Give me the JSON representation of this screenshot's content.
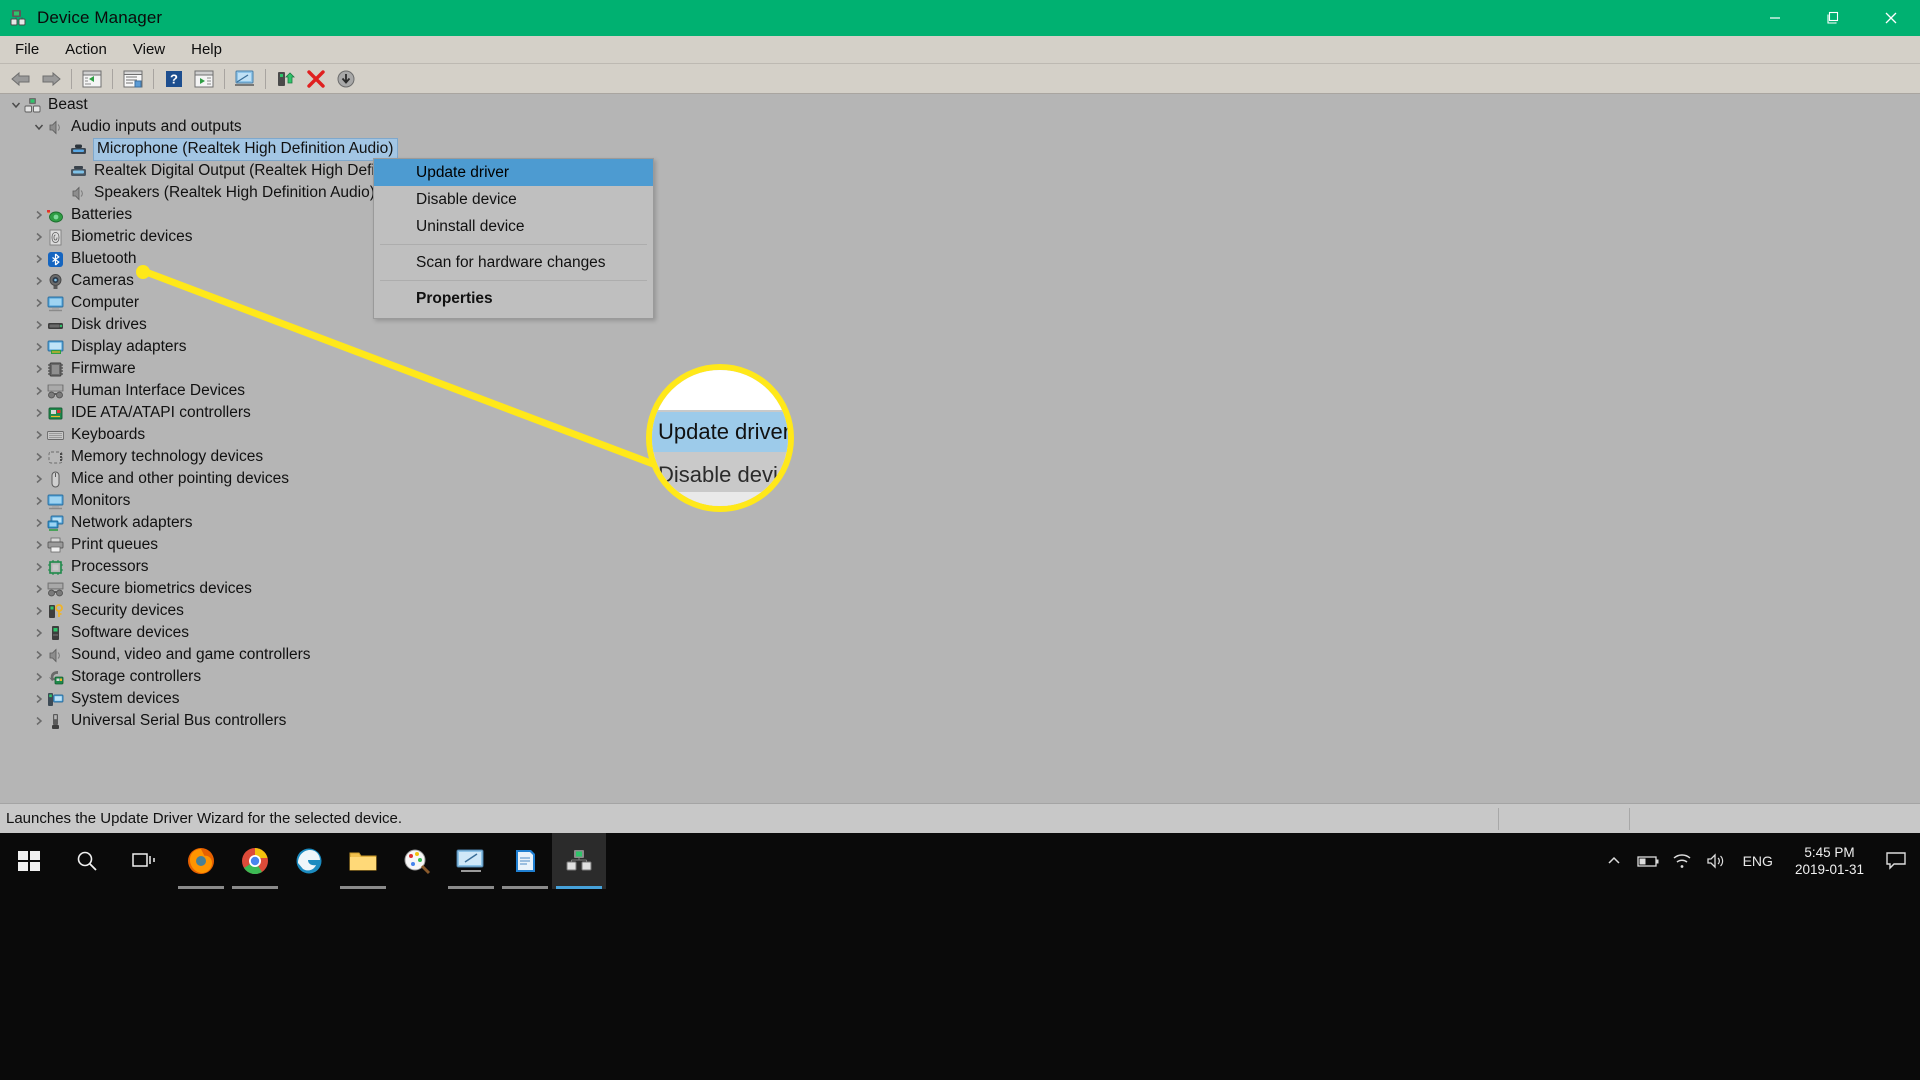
{
  "window": {
    "title": "Device Manager",
    "icon": "device-manager-icon",
    "titlebar_color": "#00b171",
    "minimize_label": "Minimize",
    "restore_label": "Restore",
    "close_label": "Close"
  },
  "menubar": {
    "items": [
      {
        "label": "File"
      },
      {
        "label": "Action"
      },
      {
        "label": "View"
      },
      {
        "label": "Help"
      }
    ]
  },
  "toolbar": {
    "items": [
      {
        "name": "back-button",
        "icon": "back-arrow-icon"
      },
      {
        "name": "forward-button",
        "icon": "forward-arrow-icon"
      },
      {
        "name": "show-hide-console-tree-button",
        "icon": "console-tree-icon"
      },
      {
        "name": "properties-button",
        "icon": "properties-icon"
      },
      {
        "name": "help-button",
        "icon": "help-question-icon"
      },
      {
        "name": "show-hide-action-pane-button",
        "icon": "action-pane-icon"
      },
      {
        "name": "scan-for-hardware-changes-button",
        "icon": "scan-monitor-icon"
      },
      {
        "name": "update-driver-button",
        "icon": "update-driver-icon"
      },
      {
        "name": "uninstall-device-button",
        "icon": "red-x-icon"
      },
      {
        "name": "disable-device-button",
        "icon": "disable-down-arrow-icon"
      }
    ]
  },
  "tree": {
    "root": {
      "label": "Beast",
      "icon": "computer-node-icon",
      "expanded": true,
      "indent": 0
    },
    "nodes": [
      {
        "label": "Beast",
        "icon": "computer-node-icon",
        "indent": 0,
        "twisty": "expanded",
        "selected": false
      },
      {
        "label": "Audio inputs and outputs",
        "icon": "speaker-icon",
        "indent": 1,
        "twisty": "expanded",
        "selected": false
      },
      {
        "label": "Microphone (Realtek High Definition Audio)",
        "icon": "microphone-icon",
        "indent": 2,
        "twisty": "none",
        "selected": true
      },
      {
        "label": "Realtek Digital Output (Realtek High Definition Audio)",
        "icon": "digital-output-icon",
        "indent": 2,
        "twisty": "none",
        "selected": false
      },
      {
        "label": "Speakers (Realtek High Definition Audio)",
        "icon": "speaker-icon",
        "indent": 2,
        "twisty": "none",
        "selected": false
      },
      {
        "label": "Batteries",
        "icon": "battery-icon",
        "indent": 1,
        "twisty": "collapsed",
        "selected": false
      },
      {
        "label": "Biometric devices",
        "icon": "fingerprint-icon",
        "indent": 1,
        "twisty": "collapsed",
        "selected": false
      },
      {
        "label": "Bluetooth",
        "icon": "bluetooth-icon",
        "indent": 1,
        "twisty": "collapsed",
        "selected": false
      },
      {
        "label": "Cameras",
        "icon": "camera-icon",
        "indent": 1,
        "twisty": "collapsed",
        "selected": false
      },
      {
        "label": "Computer",
        "icon": "monitor-icon",
        "indent": 1,
        "twisty": "collapsed",
        "selected": false
      },
      {
        "label": "Disk drives",
        "icon": "disk-drive-icon",
        "indent": 1,
        "twisty": "collapsed",
        "selected": false
      },
      {
        "label": "Display adapters",
        "icon": "display-adapter-icon",
        "indent": 1,
        "twisty": "collapsed",
        "selected": false
      },
      {
        "label": "Firmware",
        "icon": "firmware-chip-icon",
        "indent": 1,
        "twisty": "collapsed",
        "selected": false
      },
      {
        "label": "Human Interface Devices",
        "icon": "hid-gamepad-icon",
        "indent": 1,
        "twisty": "collapsed",
        "selected": false
      },
      {
        "label": "IDE ATA/ATAPI controllers",
        "icon": "ide-controller-icon",
        "indent": 1,
        "twisty": "collapsed",
        "selected": false
      },
      {
        "label": "Keyboards",
        "icon": "keyboard-icon",
        "indent": 1,
        "twisty": "collapsed",
        "selected": false
      },
      {
        "label": "Memory technology devices",
        "icon": "memory-card-icon",
        "indent": 1,
        "twisty": "collapsed",
        "selected": false
      },
      {
        "label": "Mice and other pointing devices",
        "icon": "mouse-icon",
        "indent": 1,
        "twisty": "collapsed",
        "selected": false
      },
      {
        "label": "Monitors",
        "icon": "monitor-icon",
        "indent": 1,
        "twisty": "collapsed",
        "selected": false
      },
      {
        "label": "Network adapters",
        "icon": "network-adapter-icon",
        "indent": 1,
        "twisty": "collapsed",
        "selected": false
      },
      {
        "label": "Print queues",
        "icon": "printer-icon",
        "indent": 1,
        "twisty": "collapsed",
        "selected": false
      },
      {
        "label": "Processors",
        "icon": "processor-chip-icon",
        "indent": 1,
        "twisty": "collapsed",
        "selected": false
      },
      {
        "label": "Secure biometrics devices",
        "icon": "secure-biometrics-icon",
        "indent": 1,
        "twisty": "collapsed",
        "selected": false
      },
      {
        "label": "Security devices",
        "icon": "security-key-icon",
        "indent": 1,
        "twisty": "collapsed",
        "selected": false
      },
      {
        "label": "Software devices",
        "icon": "software-device-icon",
        "indent": 1,
        "twisty": "collapsed",
        "selected": false
      },
      {
        "label": "Sound, video and game controllers",
        "icon": "speaker-icon",
        "indent": 1,
        "twisty": "collapsed",
        "selected": false
      },
      {
        "label": "Storage controllers",
        "icon": "storage-controller-icon",
        "indent": 1,
        "twisty": "collapsed",
        "selected": false
      },
      {
        "label": "System devices",
        "icon": "system-device-icon",
        "indent": 1,
        "twisty": "collapsed",
        "selected": false
      },
      {
        "label": "Universal Serial Bus controllers",
        "icon": "usb-icon",
        "indent": 1,
        "twisty": "collapsed",
        "selected": false
      }
    ]
  },
  "context_menu": {
    "items": [
      {
        "label": "Update driver",
        "highlighted": true,
        "bold": false
      },
      {
        "label": "Disable device",
        "highlighted": false,
        "bold": false
      },
      {
        "label": "Uninstall device",
        "highlighted": false,
        "bold": false
      },
      {
        "separator": true
      },
      {
        "label": "Scan for hardware changes",
        "highlighted": false,
        "bold": false
      },
      {
        "separator": true
      },
      {
        "label": "Properties",
        "highlighted": false,
        "bold": true
      }
    ],
    "highlight_color": "#4d9bd1"
  },
  "callout": {
    "accent_color": "#ffe81a",
    "magnified_item_1": "Update driver",
    "magnified_item_2": "Disable devic"
  },
  "statusbar": {
    "text": "Launches the Update Driver Wizard for the selected device."
  },
  "taskbar": {
    "start_label": "Start",
    "buttons": [
      {
        "name": "start-button",
        "icon": "windows-logo-icon",
        "state": "none"
      },
      {
        "name": "search-button",
        "icon": "search-magnifier-icon",
        "state": "none"
      },
      {
        "name": "task-view-button",
        "icon": "task-view-icon",
        "state": "none"
      },
      {
        "name": "firefox-button",
        "icon": "firefox-icon",
        "state": "open"
      },
      {
        "name": "chrome-button",
        "icon": "chrome-icon",
        "state": "open"
      },
      {
        "name": "edge-button",
        "icon": "edge-icon",
        "state": "none"
      },
      {
        "name": "file-explorer-button",
        "icon": "folder-icon",
        "state": "open"
      },
      {
        "name": "paint-button",
        "icon": "paint-icon",
        "state": "none"
      },
      {
        "name": "remote-desktop-button",
        "icon": "remote-desktop-icon",
        "state": "open"
      },
      {
        "name": "notepad-button",
        "icon": "notepad-icon",
        "state": "open"
      },
      {
        "name": "device-manager-button",
        "icon": "device-manager-icon",
        "state": "active"
      }
    ],
    "tray": {
      "overflow_icon": "chevron-up-icon",
      "battery_icon": "battery-icon",
      "network_icon": "wifi-icon",
      "volume_icon": "volume-icon",
      "language": "ENG",
      "time": "5:45 PM",
      "date": "2019-01-31",
      "action_center_icon": "action-center-icon"
    }
  }
}
